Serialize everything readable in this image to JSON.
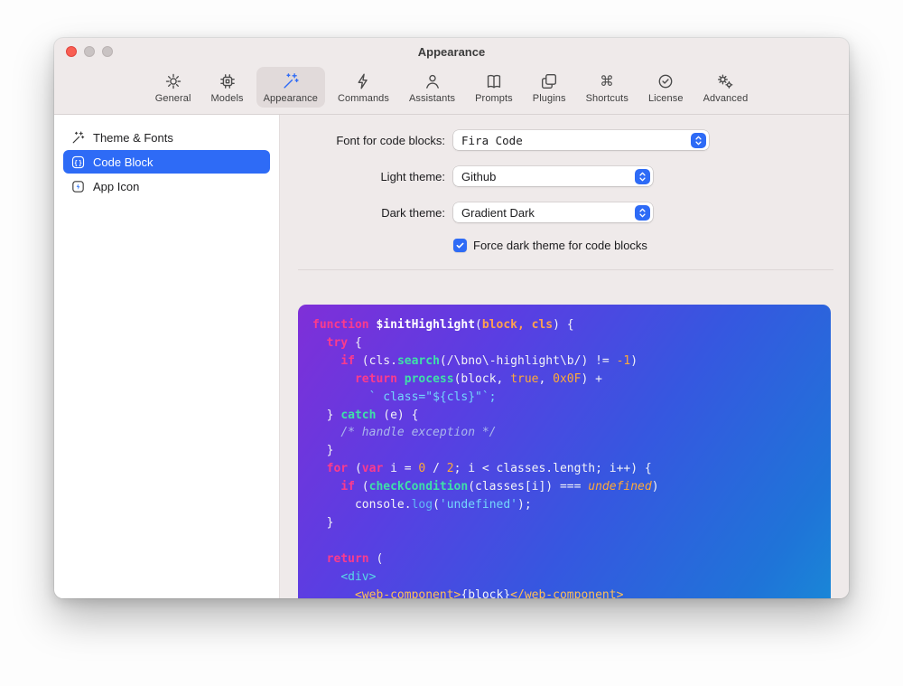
{
  "window": {
    "title": "Appearance"
  },
  "toolbar": {
    "items": [
      {
        "label": "General",
        "icon": "gear",
        "selected": false
      },
      {
        "label": "Models",
        "icon": "cpu",
        "selected": false
      },
      {
        "label": "Appearance",
        "icon": "wand-sparkles",
        "selected": true
      },
      {
        "label": "Commands",
        "icon": "bolt",
        "selected": false
      },
      {
        "label": "Assistants",
        "icon": "person",
        "selected": false
      },
      {
        "label": "Prompts",
        "icon": "book",
        "selected": false
      },
      {
        "label": "Plugins",
        "icon": "pages",
        "selected": false
      },
      {
        "label": "Shortcuts",
        "icon": "command",
        "selected": false
      },
      {
        "label": "License",
        "icon": "seal-check",
        "selected": false
      },
      {
        "label": "Advanced",
        "icon": "gears",
        "selected": false
      }
    ]
  },
  "sidebar": {
    "items": [
      {
        "label": "Theme & Fonts",
        "icon": "sparkle-wand",
        "selected": false
      },
      {
        "label": "Code Block",
        "icon": "curly-braces",
        "selected": true
      },
      {
        "label": "App Icon",
        "icon": "app-bolt",
        "selected": false
      }
    ]
  },
  "form": {
    "font_label": "Font for code blocks:",
    "font_value": "Fira Code",
    "light_label": "Light theme:",
    "light_value": "Github",
    "dark_label": "Dark theme:",
    "dark_value": "Gradient Dark",
    "force_dark_label": "Force dark theme for code blocks",
    "force_dark_checked": true
  },
  "colors": {
    "accent": "#2e6bf6",
    "code_gradient_start": "#7f2fd8",
    "code_gradient_end": "#1693d6"
  },
  "code_preview": {
    "language": "javascript",
    "lines": [
      [
        [
          "function",
          "kw"
        ],
        [
          " ",
          "pl"
        ],
        [
          "$initHighlight",
          "title"
        ],
        [
          "(",
          "pl"
        ],
        [
          "block, cls",
          "params"
        ],
        [
          ") {",
          "pl"
        ]
      ],
      [
        [
          "  ",
          "pl"
        ],
        [
          "try",
          "kw"
        ],
        [
          " {",
          "pl"
        ]
      ],
      [
        [
          "    ",
          "pl"
        ],
        [
          "if",
          "kw"
        ],
        [
          " (cls.",
          "pl"
        ],
        [
          "search",
          "fn"
        ],
        [
          "(/\\bno\\-highlight\\b/) != ",
          "pl"
        ],
        [
          "-1",
          "num"
        ],
        [
          ")",
          "pl"
        ]
      ],
      [
        [
          "      ",
          "pl"
        ],
        [
          "return",
          "kw"
        ],
        [
          " ",
          "pl"
        ],
        [
          "process",
          "fn"
        ],
        [
          "(block, ",
          "pl"
        ],
        [
          "true",
          "num"
        ],
        [
          ", ",
          "pl"
        ],
        [
          "0x0F",
          "num"
        ],
        [
          ") +",
          "pl"
        ]
      ],
      [
        [
          "        ",
          "pl"
        ],
        [
          "` class=\"${cls}\"`;",
          "str"
        ]
      ],
      [
        [
          "  } ",
          "pl"
        ],
        [
          "catch",
          "fn"
        ],
        [
          " (e) {",
          "pl"
        ]
      ],
      [
        [
          "    ",
          "pl"
        ],
        [
          "/* handle exception */",
          "cmt"
        ]
      ],
      [
        [
          "  }",
          "pl"
        ]
      ],
      [
        [
          "  ",
          "pl"
        ],
        [
          "for",
          "kw"
        ],
        [
          " (",
          "pl"
        ],
        [
          "var",
          "kw"
        ],
        [
          " i = ",
          "pl"
        ],
        [
          "0",
          "num"
        ],
        [
          " / ",
          "pl"
        ],
        [
          "2",
          "num"
        ],
        [
          "; i < classes.length; i++) {",
          "pl"
        ]
      ],
      [
        [
          "    ",
          "pl"
        ],
        [
          "if",
          "kw"
        ],
        [
          " (",
          "pl"
        ],
        [
          "checkCondition",
          "fn"
        ],
        [
          "(classes[i]) === ",
          "pl"
        ],
        [
          "undefined",
          "undef"
        ],
        [
          ")",
          "pl"
        ]
      ],
      [
        [
          "      ",
          "pl"
        ],
        [
          "console.",
          "pl"
        ],
        [
          "log",
          "method"
        ],
        [
          "(",
          "pl"
        ],
        [
          "'undefined'",
          "str"
        ],
        [
          ");",
          "pl"
        ]
      ],
      [
        [
          "  }",
          "pl"
        ]
      ],
      [],
      [
        [
          "  ",
          "pl"
        ],
        [
          "return",
          "kw"
        ],
        [
          " (",
          "pl"
        ]
      ],
      [
        [
          "    ",
          "pl"
        ],
        [
          "<div>",
          "tag"
        ]
      ],
      [
        [
          "      ",
          "pl"
        ],
        [
          "<web-component>",
          "tag2"
        ],
        [
          "{block}",
          "pl"
        ],
        [
          "</web-component>",
          "tag2"
        ]
      ]
    ]
  }
}
